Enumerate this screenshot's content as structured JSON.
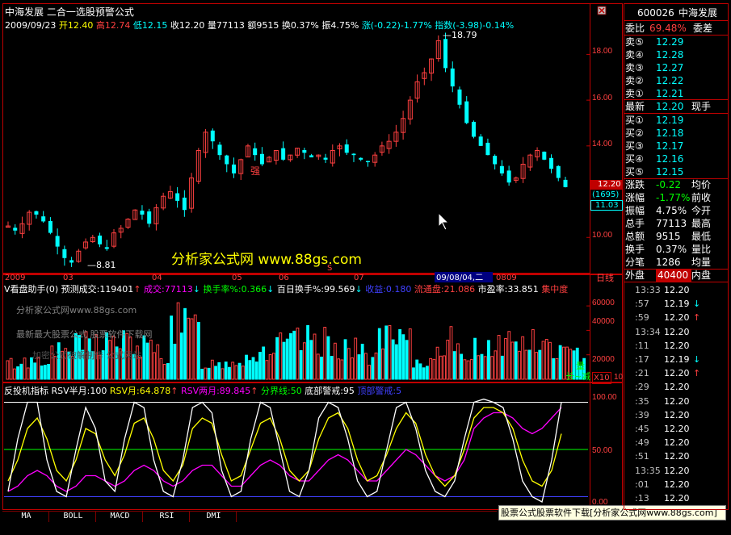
{
  "header": {
    "title": "中海发展  二合一选股预警公式",
    "date": "2009/09/23",
    "open": "开12.40",
    "high": "高12.74",
    "low": "低12.15",
    "close": "收12.20",
    "volume": "量77113",
    "amount": "额9515",
    "turnover": "换0.37%",
    "amplitude": "振4.75%",
    "change": "涨(-0.22)-1.77%",
    "index": "指数(-3.98)-0.14%"
  },
  "price_panel": {
    "high_label": "18.79",
    "low_label": "8.81",
    "strong_label": "强",
    "s_label": "S",
    "current_price": "12.20",
    "current_price2": "11.03",
    "volume_box": "(1695)",
    "y_ticks": [
      "18.00",
      "16.00",
      "14.00",
      "10.00"
    ],
    "x_ticks": [
      "2009",
      "03",
      "04",
      "05",
      "06",
      "07",
      "08",
      "09"
    ],
    "x_cursor": "09/08/04,二",
    "right_corner": "日线",
    "watermark": "分析家公式网 www.88gs.com"
  },
  "volume_panel": {
    "title": "V看盘助手(0)",
    "forecast": "预测成交:119401",
    "deal": "成交:77113",
    "turnover_pct": "换手率%:0.366",
    "hundred_day": "百日换手%:99.569",
    "gain": "收益:0.180",
    "float": "流通盘:21.086",
    "pe": "市盈率:33.851",
    "concentration": "集中度",
    "y_ticks": [
      "60000",
      "40000",
      "20000",
      "10"
    ],
    "corner_label_1": "量",
    "corner_label_2": "长~减",
    "ghost_lines": [
      "分析家公式网www.88gs.com",
      "最新最大股票公式  股票软件下载网",
      "加密公式破解制作   公式网站"
    ]
  },
  "indicator_panel": {
    "title": "反投机指标",
    "rsv_half": "RSV半月:100",
    "rsv_month": "RSV月:64.878",
    "rsv_two_month": "RSV两月:89.845",
    "divider": "分界线:50",
    "bottom_warn": "底部警戒:95",
    "top_warn": "顶部警戒:5",
    "y_ticks": [
      "100.00",
      "50.00",
      "0.00"
    ]
  },
  "tabs": [
    "MA",
    "BOLL",
    "MACD",
    "RSI",
    "DMI"
  ],
  "bottom_banner": "股票公式股票软件下载[分析家公式网www.88gs.com]",
  "quote_panel": {
    "code": "600026",
    "name": "中海发展",
    "weibi": {
      "label": "委比",
      "value": "69.48%",
      "right": "委差"
    },
    "asks": [
      {
        "label": "卖⑤",
        "value": "12.29"
      },
      {
        "label": "卖④",
        "value": "12.28"
      },
      {
        "label": "卖③",
        "value": "12.27"
      },
      {
        "label": "卖②",
        "value": "12.22"
      },
      {
        "label": "卖①",
        "value": "12.21"
      }
    ],
    "latest": {
      "label": "最新",
      "value": "12.20",
      "right": "现手"
    },
    "bids": [
      {
        "label": "买①",
        "value": "12.19"
      },
      {
        "label": "买②",
        "value": "12.18"
      },
      {
        "label": "买③",
        "value": "12.17"
      },
      {
        "label": "买④",
        "value": "12.16"
      },
      {
        "label": "买⑤",
        "value": "12.15"
      }
    ],
    "stats": [
      {
        "label": "涨跌",
        "value": "-0.22",
        "right": "均价",
        "color": "#00ff00"
      },
      {
        "label": "涨幅",
        "value": "-1.77%",
        "right": "前收",
        "color": "#00ff00"
      },
      {
        "label": "振幅",
        "value": "4.75%",
        "right": "今开",
        "color": "#ffffff"
      },
      {
        "label": "总手",
        "value": "77113",
        "right": "最高",
        "color": "#ffffff"
      },
      {
        "label": "总额",
        "value": "9515",
        "right": "最低",
        "color": "#ffffff"
      },
      {
        "label": "换手",
        "value": "0.37%",
        "right": "量比",
        "color": "#ffffff"
      },
      {
        "label": "分笔",
        "value": "1286",
        "right": "均量",
        "color": "#ffffff"
      }
    ],
    "outer": {
      "label": "外盘",
      "value": "40400",
      "right": "内盘"
    },
    "ticks": [
      {
        "time": "13:33",
        "price": "12.20",
        "arrow": ""
      },
      {
        "time": ":57",
        "price": "12.19",
        "arrow": "↓"
      },
      {
        "time": ":59",
        "price": "12.20",
        "arrow": "↑"
      },
      {
        "time": "13:34",
        "price": "12.20",
        "arrow": ""
      },
      {
        "time": ":11",
        "price": "12.20",
        "arrow": ""
      },
      {
        "time": ":17",
        "price": "12.19",
        "arrow": "↓"
      },
      {
        "time": ":21",
        "price": "12.20",
        "arrow": "↑"
      },
      {
        "time": ":29",
        "price": "12.20",
        "arrow": ""
      },
      {
        "time": ":35",
        "price": "12.20",
        "arrow": ""
      },
      {
        "time": ":39",
        "price": "12.20",
        "arrow": ""
      },
      {
        "time": ":45",
        "price": "12.20",
        "arrow": ""
      },
      {
        "time": ":49",
        "price": "12.20",
        "arrow": ""
      },
      {
        "time": ":51",
        "price": "12.20",
        "arrow": ""
      },
      {
        "time": "13:35",
        "price": "12.20",
        "arrow": ""
      },
      {
        "time": ":01",
        "price": "12.20",
        "arrow": ""
      },
      {
        "time": ":13",
        "price": "12.20",
        "arrow": ""
      }
    ]
  },
  "colors": {
    "up": "#ff4040",
    "down": "#00ffff",
    "frame": "#c00000",
    "rsv_half": "#ffffff",
    "rsv_month": "#ffff00",
    "rsv_two_month": "#ff00ff"
  },
  "chart_data": {
    "type": "candlestick",
    "x_labels": [
      "2009",
      "03",
      "04",
      "05",
      "06",
      "07",
      "08",
      "09"
    ],
    "price_max": 18.79,
    "price_min": 8.81,
    "last_close": 12.2,
    "close_path": [
      10.5,
      10.3,
      10.6,
      11.1,
      11.0,
      10.7,
      10.2,
      9.6,
      9.1,
      8.9,
      9.4,
      9.8,
      10.0,
      9.7,
      9.5,
      10.2,
      10.4,
      10.8,
      11.2,
      11.0,
      10.6,
      11.3,
      11.8,
      12.0,
      11.6,
      11.2,
      12.6,
      13.8,
      14.6,
      14.2,
      13.6,
      13.2,
      12.8,
      13.4,
      14.0,
      13.6,
      13.2,
      13.5,
      13.8,
      13.4,
      13.6,
      13.9,
      13.7,
      13.5,
      13.6,
      13.4,
      13.8,
      14.0,
      13.7,
      13.6,
      13.4,
      13.3,
      13.6,
      14.0,
      14.2,
      14.6,
      15.2,
      16.0,
      16.8,
      17.2,
      17.8,
      18.6,
      17.4,
      16.6,
      15.8,
      15.0,
      14.4,
      14.0,
      13.6,
      13.2,
      12.8,
      12.4,
      12.6,
      13.2,
      13.6,
      13.8,
      13.4,
      13.0,
      12.6,
      12.2
    ],
    "volume_max": 60000,
    "rsv_half": [
      10,
      60,
      95,
      95,
      40,
      10,
      5,
      50,
      90,
      70,
      20,
      10,
      60,
      95,
      90,
      40,
      10,
      5,
      40,
      90,
      95,
      85,
      30,
      5,
      10,
      60,
      95,
      90,
      50,
      10,
      5,
      30,
      80,
      95,
      90,
      60,
      20,
      5,
      10,
      50,
      90,
      95,
      70,
      30,
      10,
      5,
      20,
      60,
      95,
      98,
      95,
      90,
      60,
      20,
      5,
      0,
      40,
      95
    ],
    "rsv_month": [
      20,
      40,
      70,
      80,
      60,
      30,
      20,
      40,
      70,
      65,
      40,
      25,
      45,
      75,
      80,
      60,
      30,
      20,
      35,
      70,
      80,
      75,
      45,
      20,
      25,
      50,
      75,
      80,
      60,
      30,
      20,
      30,
      60,
      80,
      85,
      70,
      40,
      20,
      25,
      45,
      70,
      85,
      75,
      45,
      25,
      15,
      25,
      50,
      80,
      90,
      90,
      85,
      70,
      40,
      20,
      15,
      30,
      65
    ],
    "rsv_two_month": [
      10,
      15,
      25,
      30,
      25,
      15,
      10,
      15,
      25,
      25,
      20,
      15,
      20,
      30,
      35,
      30,
      20,
      15,
      20,
      30,
      35,
      35,
      25,
      15,
      15,
      25,
      35,
      40,
      35,
      25,
      20,
      20,
      30,
      40,
      45,
      40,
      30,
      20,
      20,
      30,
      40,
      50,
      45,
      35,
      25,
      20,
      25,
      40,
      70,
      80,
      85,
      85,
      80,
      70,
      65,
      70,
      80,
      90
    ],
    "divider": 50,
    "bottom_warn": 95,
    "top_warn": 5
  }
}
